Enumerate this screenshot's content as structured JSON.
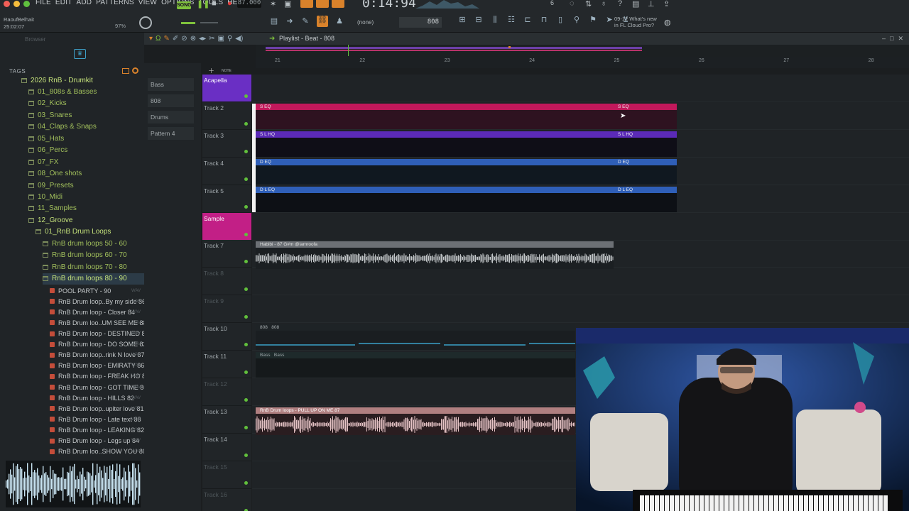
{
  "menu": [
    "File",
    "Edit",
    "Add",
    "Patterns",
    "View",
    "Options",
    "Tools",
    "Help"
  ],
  "song_mode": "SONG",
  "tempo": "87.000",
  "time": "0:14:94",
  "user": {
    "name": "RaoufBelhait",
    "time": "25:02:07"
  },
  "cpu": "97%",
  "preset": "(none)",
  "step_value": "808",
  "news": {
    "date": "09-12",
    "line1": "What's new",
    "line2": "in FL Cloud Pro?"
  },
  "browser_label": "Browser",
  "tags_label": "TAGS",
  "folders": [
    {
      "label": "2026 RnB - Drumkit",
      "level": 0,
      "open": true
    },
    {
      "label": "01_808s & Basses",
      "level": 1
    },
    {
      "label": "02_Kicks",
      "level": 1
    },
    {
      "label": "03_Snares",
      "level": 1
    },
    {
      "label": "04_Claps & Snaps",
      "level": 1
    },
    {
      "label": "05_Hats",
      "level": 1
    },
    {
      "label": "06_Percs",
      "level": 1
    },
    {
      "label": "07_FX",
      "level": 1
    },
    {
      "label": "08_One shots",
      "level": 1
    },
    {
      "label": "09_Presets",
      "level": 1
    },
    {
      "label": "10_Midi",
      "level": 1
    },
    {
      "label": "11_Samples",
      "level": 1
    },
    {
      "label": "12_Groove",
      "level": 1,
      "open": true
    },
    {
      "label": "01_RnB Drum Loops",
      "level": 2,
      "open": true
    },
    {
      "label": "RnB drum loops 50 - 60",
      "level": 3
    },
    {
      "label": "RnB drum loops 60 - 70",
      "level": 3
    },
    {
      "label": "RnB drum loops 70 - 80",
      "level": 3
    },
    {
      "label": "RnB drum loops 80 - 90",
      "level": 3,
      "open": true,
      "selected": true
    }
  ],
  "files": [
    "POOL PARTY - 90",
    "RnB Drum loop..By my side 86",
    "RnB Drum loop - Closer 84",
    "RnB Drum loo..UM SEE ME 88",
    "RnB Drum loop - DESTINED 85",
    "RnB Drum loop - DO SOME 82",
    "RnB Drum loop..rink N love 87",
    "RnB Drum loop - EMIRATY 86",
    "RnB Drum loop - FREAK HO 82",
    "RnB Drum loop - GOT TIME 86",
    "RnB Drum loop - HILLS 82",
    "RnB Drum loop..upiter love 81",
    "RnB Drum loop - Late text 88",
    "RnB Drum loop - LEAKING 82",
    "RnB Drum loop - Legs up  84",
    "RnB Drum loo..SHOW YOU 80"
  ],
  "wav_tag": "WAV",
  "playlist_title": "Playlist - Beat - 808",
  "patterns": [
    "Bass",
    "808",
    "Drums",
    "Pattern 4"
  ],
  "ruler": [
    "21",
    "22",
    "23",
    "24",
    "25",
    "26",
    "27",
    "28"
  ],
  "tracks": [
    {
      "name": "Acapella",
      "group": "purple"
    },
    {
      "name": "Track 2"
    },
    {
      "name": "Track 3"
    },
    {
      "name": "Track 4"
    },
    {
      "name": "Track 5"
    },
    {
      "name": "Sample",
      "group": "magenta"
    },
    {
      "name": "Track 7"
    },
    {
      "name": "Track 8",
      "dim": true
    },
    {
      "name": "Track 9",
      "dim": true
    },
    {
      "name": "Track 10"
    },
    {
      "name": "Track 11"
    },
    {
      "name": "Track 12",
      "dim": true
    },
    {
      "name": "Track 13"
    },
    {
      "name": "Track 14"
    },
    {
      "name": "Track 15",
      "dim": true
    },
    {
      "name": "Track 16",
      "dim": true
    }
  ],
  "clips": {
    "t2": "S EQ",
    "t3": "S L HQ",
    "t4": "D EQ",
    "t5": "D L EQ",
    "t7": "Habibi - 87 G#m @iamroofa",
    "t10a": "808",
    "t10b": "808",
    "t11a": "Bass",
    "t11b": "Bass",
    "t13": "RnB Drum loops - PULL UP ON ME 87"
  },
  "colors": {
    "accent": "#d9822b",
    "pink": "#c2185b",
    "purple": "#5b2ab8",
    "blue": "#2f5fb8",
    "green": "#61c03c"
  }
}
